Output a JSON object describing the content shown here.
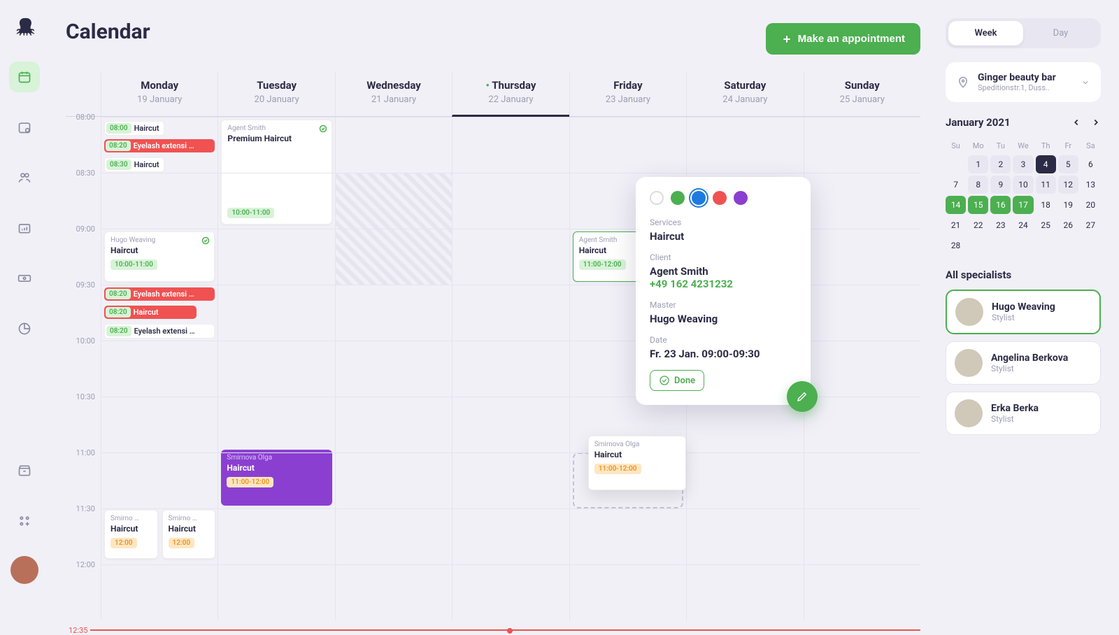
{
  "page_title": "Calendar",
  "primary_button": "Make an appointment",
  "view_toggle": {
    "week": "Week",
    "day": "Day",
    "active": "week"
  },
  "location": {
    "name": "Ginger beauty bar",
    "address": "Speditionstr.1, Duss.."
  },
  "days": [
    {
      "name": "Monday",
      "date": "19 January"
    },
    {
      "name": "Tuesday",
      "date": "20 January"
    },
    {
      "name": "Wednesday",
      "date": "21 January"
    },
    {
      "name": "Thursday",
      "date": "22 January",
      "current": true
    },
    {
      "name": "Friday",
      "date": "23 January"
    },
    {
      "name": "Saturday",
      "date": "24 January"
    },
    {
      "name": "Sunday",
      "date": "25 January"
    }
  ],
  "times": [
    "08:00",
    "08:30",
    "09:00",
    "09:30",
    "10:00",
    "10:30",
    "11:00",
    "11:30",
    "12:00"
  ],
  "now_time": "12:35",
  "events": {
    "mon_chips": [
      {
        "time": "08:00",
        "title": "Haircut",
        "style": "white"
      },
      {
        "time": "08:20",
        "title": "Eyelash extensi …",
        "style": "red"
      },
      {
        "time": "08:30",
        "title": "Haircut",
        "style": "white"
      }
    ],
    "mon_hugo": {
      "client": "Hugo Weaving",
      "title": "Haircut",
      "time": "10:00-11:00"
    },
    "mon_chips2": [
      {
        "time": "08:20",
        "title": "Eyelash extensi …",
        "style": "red"
      },
      {
        "time": "08:20",
        "title": "Haircut",
        "style": "red"
      },
      {
        "time": "08:20",
        "title": "Eyelash extensi …",
        "style": "white"
      }
    ],
    "mon_twins": [
      {
        "client": "Smirno …",
        "title": "Haircut",
        "time": "12:00"
      },
      {
        "client": "Smirno …",
        "title": "Haircut",
        "time": "12:00"
      }
    ],
    "tue_agent": {
      "client": "Agent Smith",
      "title": "Premium Haircut",
      "time": "10:00-11:00"
    },
    "tue_olga": {
      "client": "Smirnova Olga",
      "title": "Haircut",
      "time": "11:00-12:00"
    },
    "fri_agent": {
      "client": "Agent Smith",
      "title": "Haircut",
      "time": "11:00-12:00"
    },
    "fri_drag": {
      "client": "Smirnova Olga",
      "title": "Haircut",
      "time": "11:00-12:00"
    }
  },
  "popover": {
    "services_label": "Services",
    "services_value": "Haircut",
    "client_label": "Client",
    "client_value": "Agent Smith",
    "client_phone": "+49 162 4231232",
    "master_label": "Master",
    "master_value": "Hugo Weaving",
    "date_label": "Date",
    "date_value": "Fr. 23 Jan. 09:00-09:30",
    "done": "Done",
    "colors": [
      "#ffffff",
      "#4caf50",
      "#1f7ae0",
      "#f05252",
      "#8b3fd1"
    ]
  },
  "mini_cal": {
    "title": "January 2021",
    "dow": [
      "Su",
      "Mo",
      "Tu",
      "We",
      "Th",
      "Fr",
      "Sa"
    ],
    "days": [
      [
        "",
        "1",
        "2",
        "3",
        "4",
        "5",
        "6"
      ],
      [
        "7",
        "8",
        "9",
        "10",
        "11",
        "12",
        "13"
      ],
      [
        "14",
        "15",
        "16",
        "17",
        "18",
        "19",
        "20"
      ],
      [
        "21",
        "22",
        "23",
        "24",
        "25",
        "26",
        "27"
      ],
      [
        "28",
        "",
        "",
        "",
        "",
        "",
        ""
      ]
    ],
    "muted": [
      "1",
      "2",
      "3",
      "5",
      "8",
      "9",
      "10",
      "11",
      "12"
    ],
    "dark": [
      "4"
    ],
    "green": [
      "14",
      "15",
      "16",
      "17"
    ]
  },
  "specialists": {
    "title": "All specialists",
    "list": [
      {
        "name": "Hugo Weaving",
        "role": "Stylist",
        "selected": true
      },
      {
        "name": "Angelina Berkova",
        "role": "Stylist"
      },
      {
        "name": "Erka Berka",
        "role": "Stylist"
      }
    ]
  }
}
